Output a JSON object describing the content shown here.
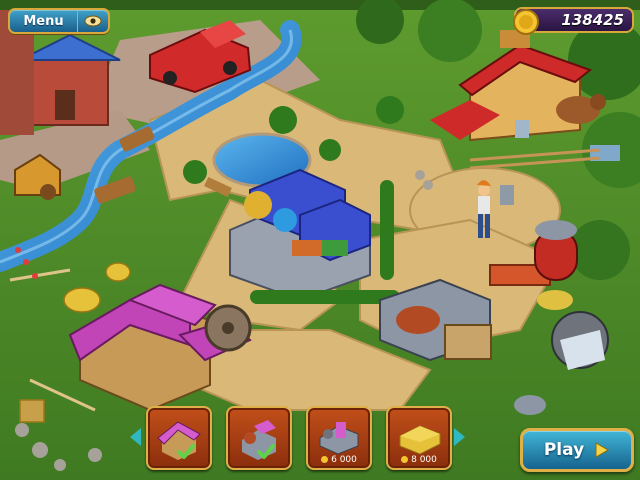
{
  "hud": {
    "menu_label": "Menu",
    "money": "138425",
    "play_label": "Play"
  },
  "toolbar": {
    "items": [
      {
        "name": "house",
        "price": "",
        "status": "purchased"
      },
      {
        "name": "workshop",
        "price": "",
        "status": "purchased"
      },
      {
        "name": "machine",
        "price": "6 000",
        "status": "available"
      },
      {
        "name": "hay",
        "price": "8 000",
        "status": "available"
      }
    ]
  },
  "colors": {
    "grass": "#4f8f2a",
    "path": "#d8b877",
    "water": "#2f8fd8",
    "frame_gold": "#e0b048",
    "button_blue": "#1b7fb0",
    "slot_red": "#a83a12"
  },
  "icons": [
    "eye-icon",
    "coin-icon",
    "checkmark-icon",
    "play-arrow-icon",
    "arrow-left-icon",
    "arrow-right-icon"
  ]
}
